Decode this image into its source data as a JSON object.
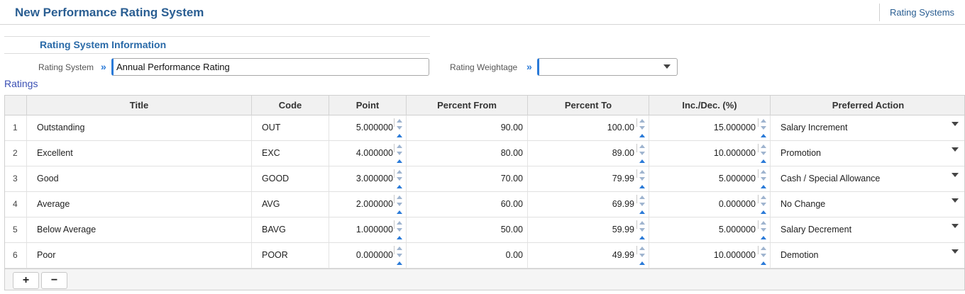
{
  "header": {
    "title": "New Performance Rating System",
    "link_label": "Rating Systems"
  },
  "section": {
    "title": "Rating System Information",
    "rating_system_label": "Rating System",
    "rating_system_value": "Annual Performance Rating",
    "rating_weightage_label": "Rating Weightage",
    "rating_weightage_value": "",
    "chevron": "»"
  },
  "ratings": {
    "label": "Ratings",
    "columns": [
      "Title",
      "Code",
      "Point",
      "Percent From",
      "Percent To",
      "Inc./Dec. (%)",
      "Preferred Action"
    ],
    "rows": [
      {
        "num": "1",
        "title": "Outstanding",
        "code": "OUT",
        "point": "5.000000",
        "from": "90.00",
        "to": "100.00",
        "incdec": "15.000000",
        "action": "Salary Increment"
      },
      {
        "num": "2",
        "title": "Excellent",
        "code": "EXC",
        "point": "4.000000",
        "from": "80.00",
        "to": "89.00",
        "incdec": "10.000000",
        "action": "Promotion"
      },
      {
        "num": "3",
        "title": "Good",
        "code": "GOOD",
        "point": "3.000000",
        "from": "70.00",
        "to": "79.99",
        "incdec": "5.000000",
        "action": "Cash / Special Allowance"
      },
      {
        "num": "4",
        "title": "Average",
        "code": "AVG",
        "point": "2.000000",
        "from": "60.00",
        "to": "69.99",
        "incdec": "0.000000",
        "action": "No Change"
      },
      {
        "num": "5",
        "title": "Below Average",
        "code": "BAVG",
        "point": "1.000000",
        "from": "50.00",
        "to": "59.99",
        "incdec": "5.000000",
        "action": "Salary Decrement"
      },
      {
        "num": "6",
        "title": "Poor",
        "code": "POOR",
        "point": "0.000000",
        "from": "0.00",
        "to": "49.99",
        "incdec": "10.000000",
        "action": "Demotion"
      }
    ],
    "add_label": "+",
    "remove_label": "−"
  },
  "colors": {
    "title_blue": "#2a5e92",
    "accent_blue": "#2a7ad8",
    "ratings_label": "#3a4fb4"
  }
}
